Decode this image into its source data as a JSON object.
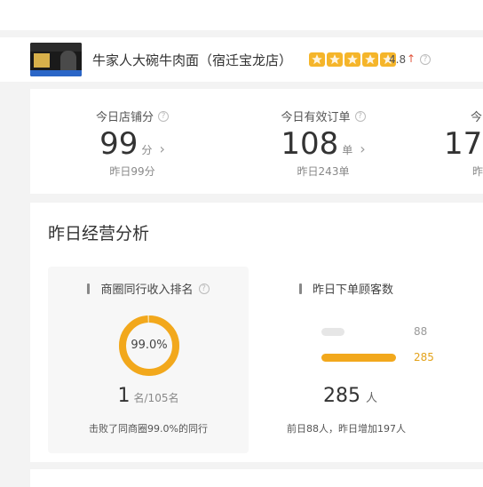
{
  "store": {
    "name": "牛家人大碗牛肉面（宿迁宝龙店）",
    "rating": "4.8",
    "rating_trend": "↑",
    "star_count": 5,
    "colors": {
      "star": "#f5b52a",
      "trend_up": "#e2553d"
    }
  },
  "stats": [
    {
      "label": "今日店铺分",
      "value": "99",
      "unit": "分",
      "sub": "昨日99分"
    },
    {
      "label": "今日有效订单",
      "value": "108",
      "unit": "单",
      "sub": "昨日243单"
    },
    {
      "label": "今",
      "value": "17",
      "unit": "",
      "sub": "昨"
    }
  ],
  "analysis": {
    "title": "昨日经营分析",
    "rank_panel": {
      "title": "商圈同行收入排名",
      "ring_percent": 99.0,
      "ring_label": "99.0%",
      "rank_value": "1",
      "rank_rest": "名/105名",
      "footer": "击败了同商圈99.0%的同行",
      "colors": {
        "ring": "#f2a81c",
        "ring_track": "#f6d99a"
      }
    },
    "customer_panel": {
      "title": "昨日下单顾客数",
      "bars": [
        {
          "value": 88,
          "label": "88",
          "color": "#e6e6e6",
          "label_color": "#999999"
        },
        {
          "value": 285,
          "label": "285",
          "color": "#f2a81c",
          "label_color": "#e3a21a"
        }
      ],
      "total_value": "285",
      "total_unit": "人",
      "footer": "前日88人，昨日增加197人"
    }
  }
}
